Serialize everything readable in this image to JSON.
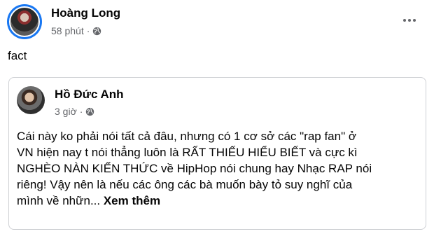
{
  "post": {
    "author": "Hoàng Long",
    "time": "58 phút",
    "separator": "·",
    "privacy_icon": "globe-icon",
    "text": "fact"
  },
  "shared": {
    "author": "Hồ Đức Anh",
    "time": "3 giờ",
    "separator": "·",
    "privacy_icon": "globe-icon",
    "lines": [
      "Cái này ko phải nói tất cả đâu, nhưng có 1 cơ sở các \"rap fan\" ở",
      "VN hiện nay t nói thẳng luôn là RẤT THIẾU HIỂU BIẾT và cực kì",
      "NGHÈO NÀN KIẾN THỨC về HipHop nói chung hay Nhạc RAP nói",
      "riêng! Vậy nên là nếu các ông các bà muốn bày tỏ suy nghĩ của",
      "mình về nhữn... "
    ],
    "see_more": "Xem thêm"
  },
  "colors": {
    "name": "#050505",
    "meta": "#65676b",
    "story_ring": "#1877f2",
    "card_border": "#ced0d4"
  }
}
